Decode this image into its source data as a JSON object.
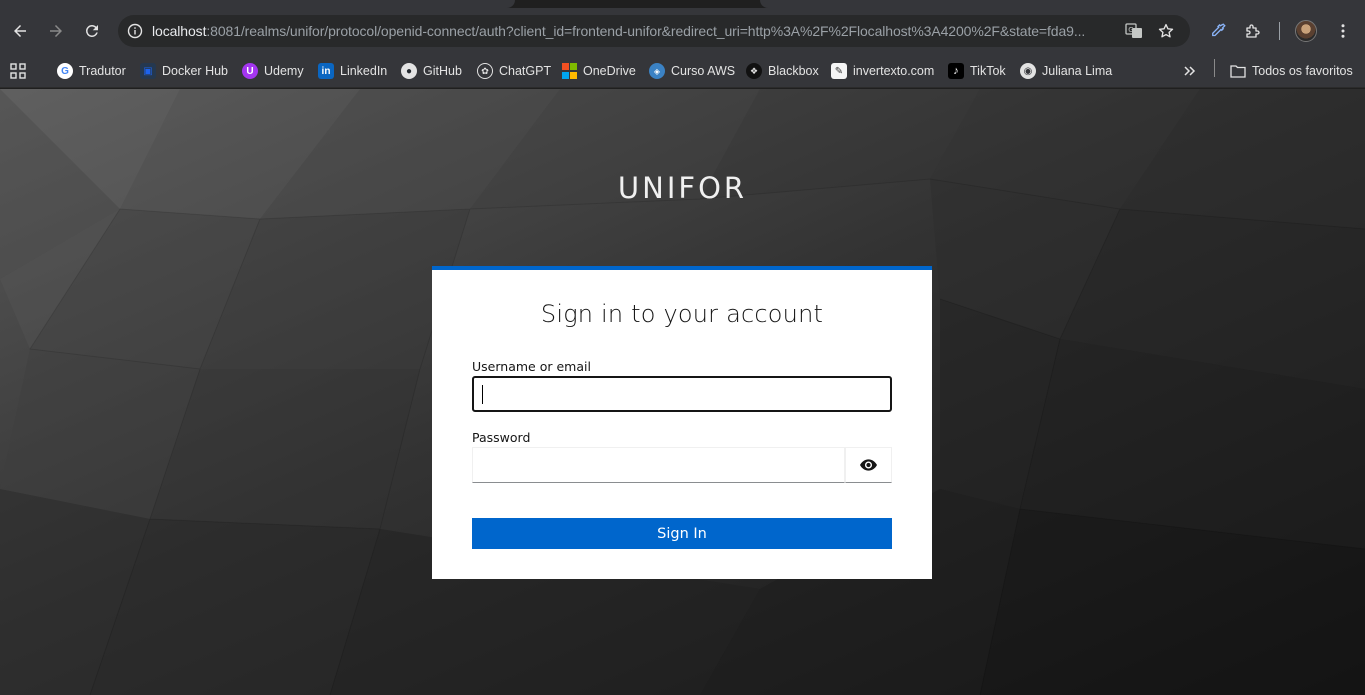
{
  "browser": {
    "url_host": "localhost",
    "url_rest": ":8081/realms/unifor/protocol/openid-connect/auth?client_id=frontend-unifor&redirect_uri=http%3A%2F%2Flocalhost%3A4200%2F&state=fda9..."
  },
  "bookmarks": {
    "items": [
      {
        "label": "Tradutor",
        "icon": "google-icon"
      },
      {
        "label": "Docker Hub",
        "icon": "docker-icon"
      },
      {
        "label": "Udemy",
        "icon": "udemy-icon"
      },
      {
        "label": "LinkedIn",
        "icon": "linkedin-icon"
      },
      {
        "label": "GitHub",
        "icon": "github-icon"
      },
      {
        "label": "ChatGPT",
        "icon": "chatgpt-icon"
      },
      {
        "label": "OneDrive",
        "icon": "microsoft-icon"
      },
      {
        "label": "Curso AWS",
        "icon": "aws-icon"
      },
      {
        "label": "Blackbox",
        "icon": "blackbox-icon"
      },
      {
        "label": "invertexto.com",
        "icon": "invertexto-icon"
      },
      {
        "label": "TikTok",
        "icon": "tiktok-icon"
      },
      {
        "label": "Juliana Lima",
        "icon": "globe-icon"
      }
    ],
    "all_bookmarks_label": "Todos os favoritos"
  },
  "login": {
    "realm_name": "UNIFOR",
    "title": "Sign in to your account",
    "username_label": "Username or email",
    "username_value": "",
    "password_label": "Password",
    "password_value": "",
    "signin_label": "Sign In",
    "accent_color": "#0066cc"
  }
}
